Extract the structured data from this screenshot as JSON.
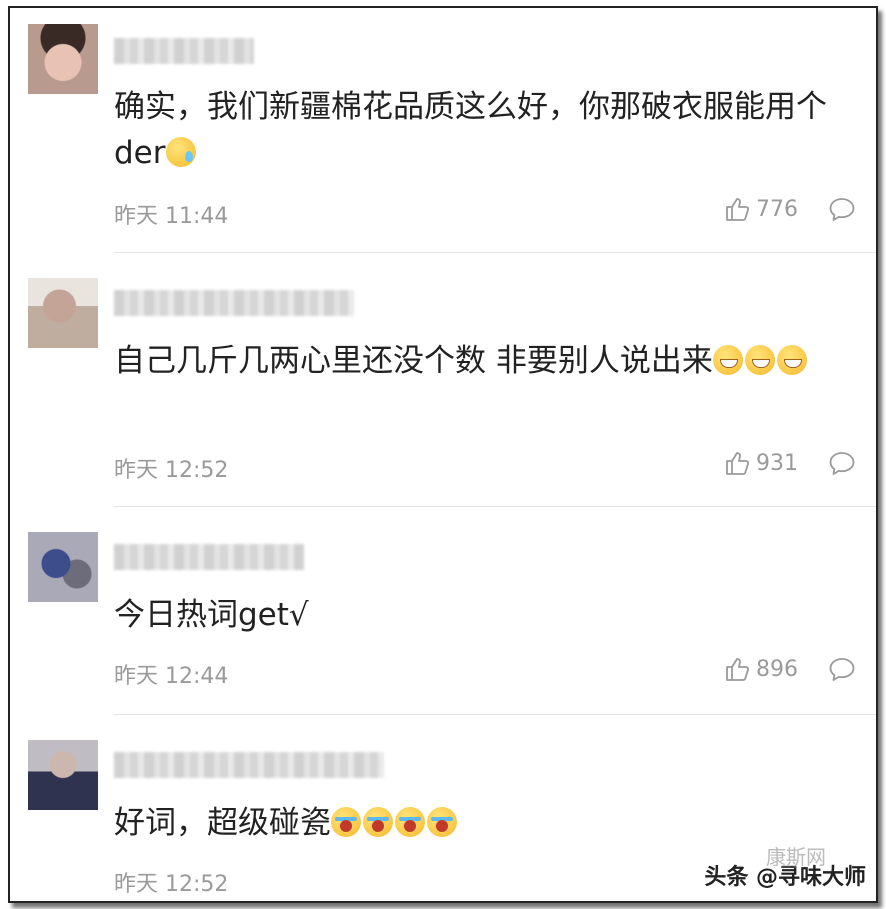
{
  "comments": [
    {
      "text": "确实，我们新疆棉花品质这么好，你那破衣服能用个der",
      "emoji": "sweat-face",
      "time": "昨天 11:44",
      "likes": "776"
    },
    {
      "text": "自己几斤几两心里还没个数 非要别人说出来",
      "emoji": "grinning-squint-face",
      "time": "昨天 12:52",
      "likes": "931"
    },
    {
      "text": "今日热词get√",
      "time": "昨天 12:44",
      "likes": "896"
    },
    {
      "text": "好词，超级碰瓷",
      "emoji": "loudly-crying-face",
      "time": "昨天 12:52"
    }
  ],
  "watermark": {
    "text": "头条 @寻味大师",
    "faint_text": "康斯网"
  },
  "colors": {
    "text": "#222222",
    "meta": "#9a9a9a",
    "divider": "#e4e4e4"
  }
}
